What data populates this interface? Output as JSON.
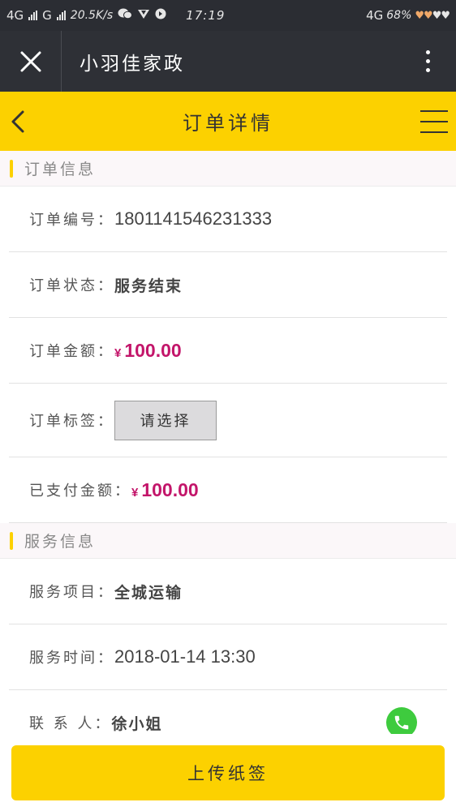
{
  "status_bar": {
    "net1": "4G",
    "net2": "G",
    "speed": "20.5K/s",
    "time": "17:19",
    "net3": "4G",
    "battery": "68%",
    "icons": [
      "signal-icon",
      "wechat-icon",
      "vpn-icon",
      "app-icon",
      "heart-icon"
    ]
  },
  "title_bar": {
    "app_name": "小羽佳家政"
  },
  "header": {
    "title": "订单详情"
  },
  "order_section": {
    "heading": "订单信息",
    "order_no_label": "订单编号：",
    "order_no": "1801141546231333",
    "status_label": "订单状态：",
    "status": "服务结束",
    "amount_label": "订单金额：",
    "currency": "¥",
    "amount": "100.00",
    "tag_label": "订单标签：",
    "tag_select": "请选择",
    "paid_label": "已支付金额：",
    "paid_amount": "100.00"
  },
  "service_section": {
    "heading": "服务信息",
    "item_label": "服务项目：",
    "item": "全城运输",
    "time_label": "服务时间：",
    "time": "2018-01-14 13:30",
    "contact_label": "联 系 人：",
    "contact": "徐小姐"
  },
  "footer": {
    "upload_button": "上传纸签"
  },
  "colors": {
    "accent": "#fcd100",
    "money": "#c3156a",
    "call": "#3ecb3e",
    "dark_bar": "#2e3036"
  }
}
